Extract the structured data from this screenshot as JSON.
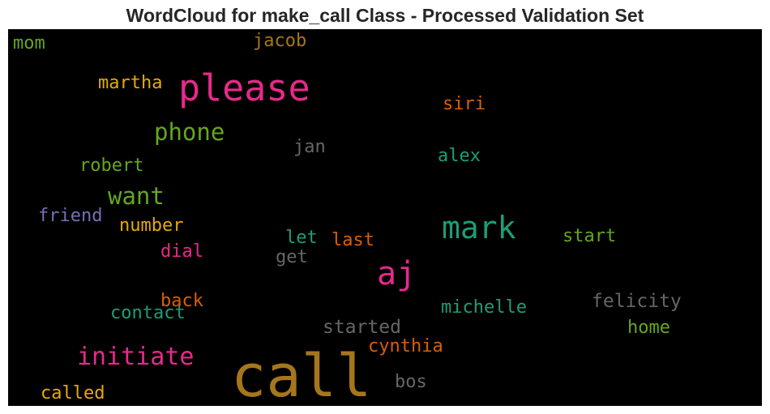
{
  "chart_data": {
    "type": "wordcloud",
    "title": "WordCloud for make_call Class - Processed Validation Set",
    "words": [
      {
        "text": "call",
        "weight": 1.0,
        "color": "#a6761d"
      },
      {
        "text": "please",
        "weight": 0.62,
        "color": "#e7298a"
      },
      {
        "text": "aj",
        "weight": 0.55,
        "color": "#e7298a"
      },
      {
        "text": "mark",
        "weight": 0.53,
        "color": "#1b9e77"
      },
      {
        "text": "initiate",
        "weight": 0.42,
        "color": "#e7298a"
      },
      {
        "text": "phone",
        "weight": 0.4,
        "color": "#66a61e"
      },
      {
        "text": "want",
        "weight": 0.4,
        "color": "#66a61e"
      },
      {
        "text": "felicity",
        "weight": 0.32,
        "color": "#666666"
      },
      {
        "text": "started",
        "weight": 0.32,
        "color": "#666666"
      },
      {
        "text": "michelle",
        "weight": 0.3,
        "color": "#1b9e77"
      },
      {
        "text": "contact",
        "weight": 0.3,
        "color": "#1b9e77"
      },
      {
        "text": "back",
        "weight": 0.3,
        "color": "#d95f02"
      },
      {
        "text": "cynthia",
        "weight": 0.3,
        "color": "#d95f02"
      },
      {
        "text": "martha",
        "weight": 0.3,
        "color": "#e6ab02"
      },
      {
        "text": "jacob",
        "weight": 0.3,
        "color": "#a6761d"
      },
      {
        "text": "mom",
        "weight": 0.3,
        "color": "#66a61e"
      },
      {
        "text": "siri",
        "weight": 0.3,
        "color": "#d95f02"
      },
      {
        "text": "jan",
        "weight": 0.3,
        "color": "#666666"
      },
      {
        "text": "alex",
        "weight": 0.3,
        "color": "#1b9e77"
      },
      {
        "text": "robert",
        "weight": 0.3,
        "color": "#66a61e"
      },
      {
        "text": "friend",
        "weight": 0.3,
        "color": "#7570b3"
      },
      {
        "text": "number",
        "weight": 0.3,
        "color": "#e6ab02"
      },
      {
        "text": "let",
        "weight": 0.3,
        "color": "#1b9e77"
      },
      {
        "text": "last",
        "weight": 0.3,
        "color": "#d95f02"
      },
      {
        "text": "start",
        "weight": 0.3,
        "color": "#66a61e"
      },
      {
        "text": "dial",
        "weight": 0.3,
        "color": "#e7298a"
      },
      {
        "text": "get",
        "weight": 0.3,
        "color": "#666666"
      },
      {
        "text": "home",
        "weight": 0.3,
        "color": "#66a61e"
      },
      {
        "text": "called",
        "weight": 0.3,
        "color": "#e6ab02"
      },
      {
        "text": "bos",
        "weight": 0.3,
        "color": "#666666"
      }
    ]
  }
}
